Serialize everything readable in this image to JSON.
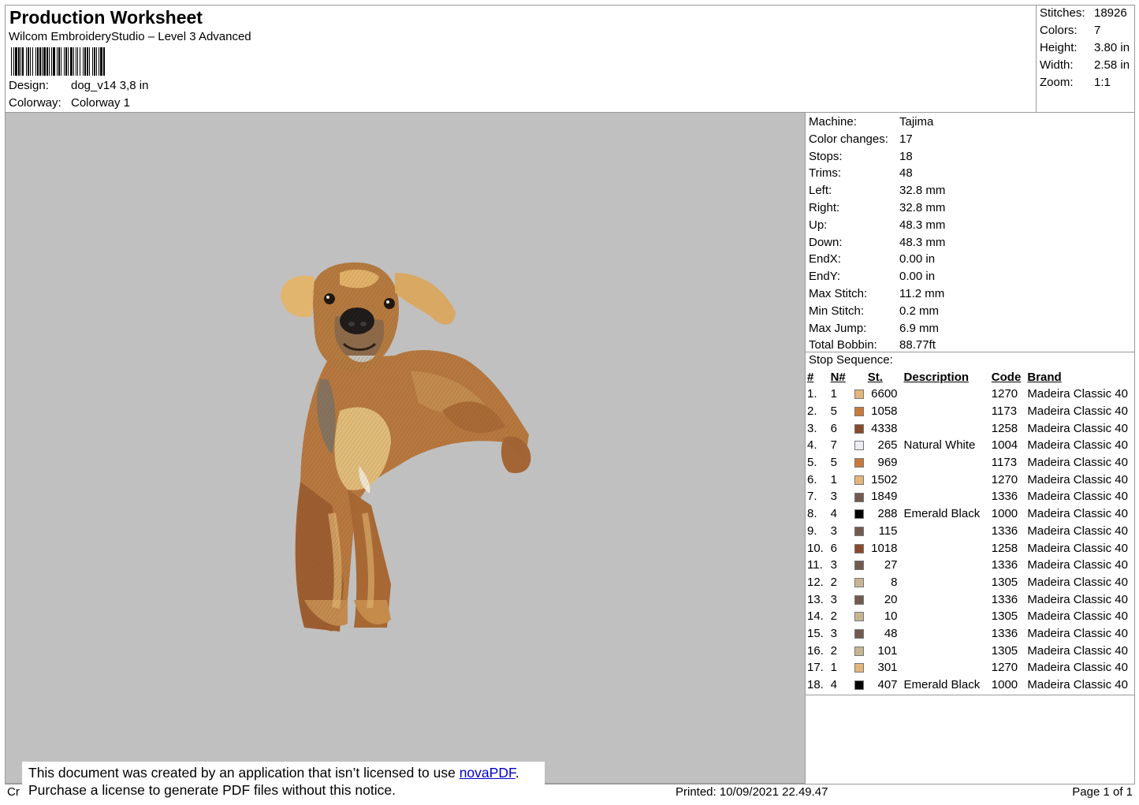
{
  "header": {
    "title": "Production Worksheet",
    "software": "Wilcom EmbroideryStudio – Level 3 Advanced",
    "design_label": "Design:",
    "design_value": "dog_v14 3,8 in",
    "colorway_label": "Colorway:",
    "colorway_value": "Colorway 1"
  },
  "summary": [
    {
      "label": "Stitches:",
      "value": "18926"
    },
    {
      "label": "Colors:",
      "value": "7"
    },
    {
      "label": "Height:",
      "value": "3.80 in"
    },
    {
      "label": "Width:",
      "value": "2.58 in"
    },
    {
      "label": "Zoom:",
      "value": "1:1"
    }
  ],
  "details": [
    {
      "label": "Machine:",
      "value": "Tajima"
    },
    {
      "label": "Color changes:",
      "value": "17"
    },
    {
      "label": "Stops:",
      "value": "18"
    },
    {
      "label": "Trims:",
      "value": "48"
    },
    {
      "label": "Left:",
      "value": "32.8 mm"
    },
    {
      "label": "Right:",
      "value": "32.8 mm"
    },
    {
      "label": "Up:",
      "value": "48.3 mm"
    },
    {
      "label": "Down:",
      "value": "48.3 mm"
    },
    {
      "label": "EndX:",
      "value": "0.00 in"
    },
    {
      "label": "EndY:",
      "value": "0.00 in"
    },
    {
      "label": "Max Stitch:",
      "value": "11.2 mm"
    },
    {
      "label": "Min Stitch:",
      "value": "0.2 mm"
    },
    {
      "label": "Max Jump:",
      "value": "6.9 mm"
    },
    {
      "label": "Total Bobbin:",
      "value": "88.77ft"
    }
  ],
  "stop_sequence": {
    "title": "Stop Sequence:",
    "columns": [
      "#",
      "N#",
      "St.",
      "Description",
      "Code",
      "Brand"
    ],
    "rows": [
      {
        "idx": "1.",
        "n": "1",
        "color": "#e3b57a",
        "st": "6600",
        "desc": "",
        "code": "1270",
        "brand": "Madeira Classic 40"
      },
      {
        "idx": "2.",
        "n": "5",
        "color": "#c87a3c",
        "st": "1058",
        "desc": "",
        "code": "1173",
        "brand": "Madeira Classic 40"
      },
      {
        "idx": "3.",
        "n": "6",
        "color": "#8a4a2c",
        "st": "4338",
        "desc": "",
        "code": "1258",
        "brand": "Madeira Classic 40"
      },
      {
        "idx": "4.",
        "n": "7",
        "color": "#ececf2",
        "st": "265",
        "desc": "Natural White",
        "code": "1004",
        "brand": "Madeira Classic 40"
      },
      {
        "idx": "5.",
        "n": "5",
        "color": "#c87a3c",
        "st": "969",
        "desc": "",
        "code": "1173",
        "brand": "Madeira Classic 40"
      },
      {
        "idx": "6.",
        "n": "1",
        "color": "#e3b57a",
        "st": "1502",
        "desc": "",
        "code": "1270",
        "brand": "Madeira Classic 40"
      },
      {
        "idx": "7.",
        "n": "3",
        "color": "#735a50",
        "st": "1849",
        "desc": "",
        "code": "1336",
        "brand": "Madeira Classic 40"
      },
      {
        "idx": "8.",
        "n": "4",
        "color": "#000000",
        "st": "288",
        "desc": "Emerald Black",
        "code": "1000",
        "brand": "Madeira Classic 40"
      },
      {
        "idx": "9.",
        "n": "3",
        "color": "#735a50",
        "st": "115",
        "desc": "",
        "code": "1336",
        "brand": "Madeira Classic 40"
      },
      {
        "idx": "10.",
        "n": "6",
        "color": "#8a4a2c",
        "st": "1018",
        "desc": "",
        "code": "1258",
        "brand": "Madeira Classic 40"
      },
      {
        "idx": "11.",
        "n": "3",
        "color": "#735a50",
        "st": "27",
        "desc": "",
        "code": "1336",
        "brand": "Madeira Classic 40"
      },
      {
        "idx": "12.",
        "n": "2",
        "color": "#c6b593",
        "st": "8",
        "desc": "",
        "code": "1305",
        "brand": "Madeira Classic 40"
      },
      {
        "idx": "13.",
        "n": "3",
        "color": "#735a50",
        "st": "20",
        "desc": "",
        "code": "1336",
        "brand": "Madeira Classic 40"
      },
      {
        "idx": "14.",
        "n": "2",
        "color": "#c6b593",
        "st": "10",
        "desc": "",
        "code": "1305",
        "brand": "Madeira Classic 40"
      },
      {
        "idx": "15.",
        "n": "3",
        "color": "#735a50",
        "st": "48",
        "desc": "",
        "code": "1336",
        "brand": "Madeira Classic 40"
      },
      {
        "idx": "16.",
        "n": "2",
        "color": "#c6b593",
        "st": "101",
        "desc": "",
        "code": "1305",
        "brand": "Madeira Classic 40"
      },
      {
        "idx": "17.",
        "n": "1",
        "color": "#e3b57a",
        "st": "301",
        "desc": "",
        "code": "1270",
        "brand": "Madeira Classic 40"
      },
      {
        "idx": "18.",
        "n": "4",
        "color": "#000000",
        "st": "407",
        "desc": "Emerald Black",
        "code": "1000",
        "brand": "Madeira Classic 40"
      }
    ]
  },
  "footer": {
    "left": "Cr",
    "printed": "Printed: 10/09/2021 22.49.47",
    "page": "Page 1 of 1"
  },
  "notice": {
    "line1_prefix": "This document was created by an application that isn’t licensed to use ",
    "link_text": "novaPDF",
    "line1_suffix": ".",
    "line2": "Purchase a license to generate PDF files without this notice."
  },
  "colors": {
    "canvas_bg": "#c0c0c0",
    "border": "#9a9a9a",
    "link": "#0000cc"
  }
}
